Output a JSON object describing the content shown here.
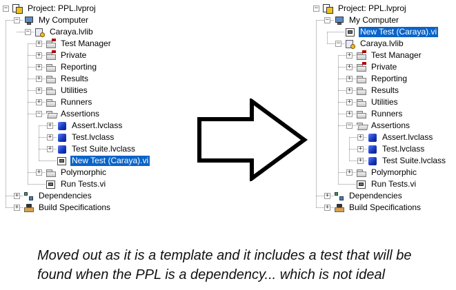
{
  "before_tree": {
    "rows": [
      {
        "label": "Project: PPL.lvproj",
        "icon": "project-icon",
        "level": 0,
        "expander": "minus"
      },
      {
        "label": "My Computer",
        "icon": "computer-icon",
        "level": 1,
        "expander": "minus"
      },
      {
        "label": "Caraya.lvlib",
        "icon": "library-icon",
        "level": 2,
        "expander": "minus"
      },
      {
        "label": "Test Manager",
        "icon": "private-folder-icon",
        "level": 3,
        "expander": "plus"
      },
      {
        "label": "Private",
        "icon": "private-folder-icon",
        "level": 3,
        "expander": "plus"
      },
      {
        "label": "Reporting",
        "icon": "folder-icon",
        "level": 3,
        "expander": "plus"
      },
      {
        "label": "Results",
        "icon": "folder-icon",
        "level": 3,
        "expander": "plus"
      },
      {
        "label": "Utilities",
        "icon": "folder-icon",
        "level": 3,
        "expander": "plus"
      },
      {
        "label": "Runners",
        "icon": "folder-icon",
        "level": 3,
        "expander": "plus"
      },
      {
        "label": "Assertions",
        "icon": "open-folder-icon",
        "level": 3,
        "expander": "minus"
      },
      {
        "label": "Assert.lvclass",
        "icon": "class-icon",
        "level": 4,
        "expander": "plus"
      },
      {
        "label": "Test.lvclass",
        "icon": "class-icon",
        "level": 4,
        "expander": "plus"
      },
      {
        "label": "Test Suite.lvclass",
        "icon": "class-icon",
        "level": 4,
        "expander": "plus"
      },
      {
        "label": "New Test (Caraya).vi",
        "icon": "vi-icon",
        "level": 4,
        "expander": "none",
        "selected": true
      },
      {
        "label": "Polymorphic",
        "icon": "folder-icon",
        "level": 3,
        "expander": "plus"
      },
      {
        "label": "Run Tests.vi",
        "icon": "vi-icon",
        "level": 3,
        "expander": "none"
      },
      {
        "label": "Dependencies",
        "icon": "dependencies-icon",
        "level": 1,
        "expander": "plus"
      },
      {
        "label": "Build Specifications",
        "icon": "build-specifications-icon",
        "level": 1,
        "expander": "plus"
      }
    ]
  },
  "after_tree": {
    "rows": [
      {
        "label": "Project: PPL.lvproj",
        "icon": "project-icon",
        "level": 0,
        "expander": "minus"
      },
      {
        "label": "My Computer",
        "icon": "computer-icon",
        "level": 1,
        "expander": "minus"
      },
      {
        "label": "New Test (Caraya).vi",
        "icon": "vi-icon",
        "level": 2,
        "expander": "none",
        "selected": true
      },
      {
        "label": "Caraya.lvlib",
        "icon": "library-icon",
        "level": 2,
        "expander": "minus"
      },
      {
        "label": "Test Manager",
        "icon": "private-folder-icon",
        "level": 3,
        "expander": "plus"
      },
      {
        "label": "Private",
        "icon": "private-folder-icon",
        "level": 3,
        "expander": "plus"
      },
      {
        "label": "Reporting",
        "icon": "folder-icon",
        "level": 3,
        "expander": "plus"
      },
      {
        "label": "Results",
        "icon": "folder-icon",
        "level": 3,
        "expander": "plus"
      },
      {
        "label": "Utilities",
        "icon": "folder-icon",
        "level": 3,
        "expander": "plus"
      },
      {
        "label": "Runners",
        "icon": "folder-icon",
        "level": 3,
        "expander": "plus"
      },
      {
        "label": "Assertions",
        "icon": "open-folder-icon",
        "level": 3,
        "expander": "minus"
      },
      {
        "label": "Assert.lvclass",
        "icon": "class-icon",
        "level": 4,
        "expander": "plus"
      },
      {
        "label": "Test.lvclass",
        "icon": "class-icon",
        "level": 4,
        "expander": "plus"
      },
      {
        "label": "Test Suite.lvclass",
        "icon": "class-icon",
        "level": 4,
        "expander": "plus"
      },
      {
        "label": "Polymorphic",
        "icon": "folder-icon",
        "level": 3,
        "expander": "plus"
      },
      {
        "label": "Run Tests.vi",
        "icon": "vi-icon",
        "level": 3,
        "expander": "none"
      },
      {
        "label": "Dependencies",
        "icon": "dependencies-icon",
        "level": 1,
        "expander": "plus"
      },
      {
        "label": "Build Specifications",
        "icon": "build-specifications-icon",
        "level": 1,
        "expander": "plus"
      }
    ]
  },
  "arrow": {
    "icon": "right-arrow-icon"
  },
  "note": {
    "line1": "Moved out as it is a template and it includes a test that will be",
    "line2": "found when the PPL is a dependency... which is not ideal"
  },
  "colors": {
    "selection": "#0a64c8",
    "selection_text": "#ffffff",
    "tree_lines": "#8a8a8a"
  }
}
